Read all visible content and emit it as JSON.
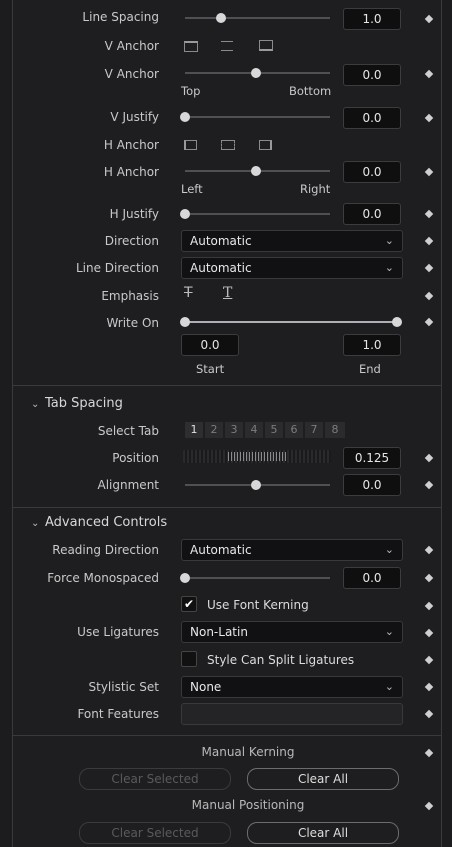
{
  "rows": {
    "line_spacing": {
      "label": "Line Spacing",
      "value": "1.0"
    },
    "v_anchor_buttons": {
      "label": "V Anchor",
      "icons": [
        "anchor-top-icon",
        "anchor-center-icon",
        "anchor-bottom-icon"
      ]
    },
    "v_anchor_slider": {
      "label": "V Anchor",
      "value": "0.0",
      "left_text": "Top",
      "right_text": "Bottom"
    },
    "v_justify": {
      "label": "V Justify",
      "value": "0.0"
    },
    "h_anchor_buttons": {
      "label": "H Anchor",
      "icons": [
        "anchor-left-icon",
        "anchor-middle-icon",
        "anchor-right-icon"
      ]
    },
    "h_anchor_slider": {
      "label": "H Anchor",
      "value": "0.0",
      "left_text": "Left",
      "right_text": "Right"
    },
    "h_justify": {
      "label": "H Justify",
      "value": "0.0"
    },
    "direction": {
      "label": "Direction",
      "value": "Automatic"
    },
    "line_direction": {
      "label": "Line Direction",
      "value": "Automatic"
    },
    "emphasis": {
      "label": "Emphasis"
    },
    "write_on": {
      "label": "Write On",
      "start": "0.0",
      "end": "1.0",
      "start_label": "Start",
      "end_label": "End"
    }
  },
  "tab_spacing": {
    "header": "Tab Spacing",
    "select_tab_label": "Select Tab",
    "tabs": [
      "1",
      "2",
      "3",
      "4",
      "5",
      "6",
      "7",
      "8"
    ],
    "selected_tab": "1",
    "position_label": "Position",
    "position_value": "0.125",
    "alignment_label": "Alignment",
    "alignment_value": "0.0"
  },
  "advanced": {
    "header": "Advanced Controls",
    "reading_direction_label": "Reading Direction",
    "reading_direction_value": "Automatic",
    "force_mono_label": "Force Monospaced",
    "force_mono_value": "0.0",
    "use_font_kerning_label": "Use Font Kerning",
    "use_font_kerning_checked": true,
    "use_ligatures_label": "Use Ligatures",
    "use_ligatures_value": "Non-Latin",
    "style_split_label": "Style Can Split Ligatures",
    "style_split_checked": false,
    "stylistic_set_label": "Stylistic Set",
    "stylistic_set_value": "None",
    "font_features_label": "Font Features",
    "font_features_value": ""
  },
  "manual": {
    "kerning_label": "Manual Kerning",
    "positioning_label": "Manual Positioning",
    "clear_selected": "Clear Selected",
    "clear_all": "Clear All"
  }
}
